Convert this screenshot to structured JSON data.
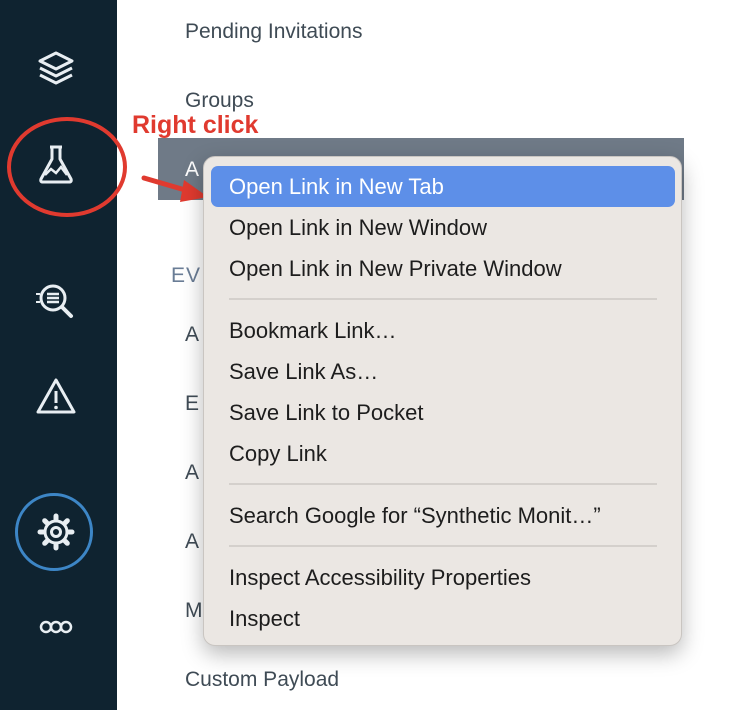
{
  "sidebar": {
    "items": [
      {
        "name": "layers-icon"
      },
      {
        "name": "flask-icon"
      },
      {
        "name": "log-search-icon"
      },
      {
        "name": "warning-icon"
      },
      {
        "name": "gear-icon"
      },
      {
        "name": "more-dots-icon"
      }
    ]
  },
  "nav": {
    "pending_invitations": "Pending Invitations",
    "groups": "Groups",
    "selected_initial": "A",
    "section_initial": "EV",
    "item_a1": "A",
    "item_e": "E",
    "item_a2": "A",
    "item_a3": "A",
    "item_m": "M",
    "custom_payload": "Custom Payload"
  },
  "annotation": {
    "label": "Right click",
    "color": "#e03a2f"
  },
  "context_menu": {
    "open_new_tab": "Open Link in New Tab",
    "open_new_window": "Open Link in New Window",
    "open_private_window": "Open Link in New Private Window",
    "bookmark_link": "Bookmark Link…",
    "save_link_as": "Save Link As…",
    "save_to_pocket": "Save Link to Pocket",
    "copy_link": "Copy Link",
    "search_google": "Search Google for “Synthetic Monit…”",
    "inspect_accessibility": "Inspect Accessibility Properties",
    "inspect": "Inspect",
    "highlight_color": "#5d8fe8"
  },
  "colors": {
    "sidebar_bg": "#0f2330",
    "selected_row": "#6f7a87",
    "settings_ring": "#3d86c6"
  }
}
